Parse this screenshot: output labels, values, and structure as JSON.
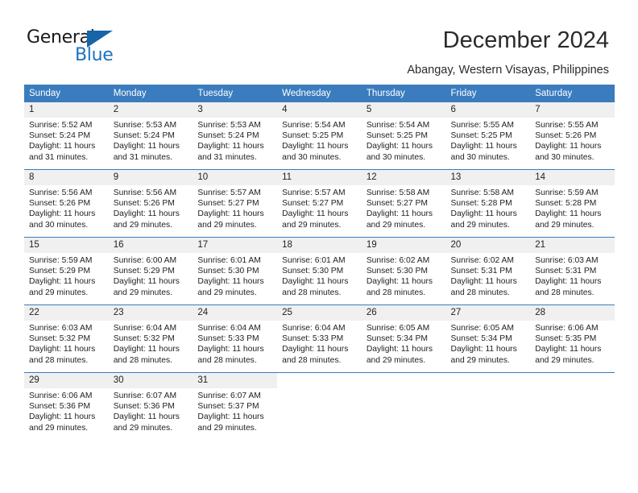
{
  "brand": {
    "name_part1": "General",
    "name_part2": "Blue",
    "flag_icon": "triangle-flag-icon"
  },
  "header": {
    "title": "December 2024",
    "location": "Abangay, Western Visayas, Philippines"
  },
  "colors": {
    "header_blue": "#3a7cbe",
    "brand_blue": "#1b72c0",
    "daynum_band": "#f0f0f0",
    "text": "#222222"
  },
  "weekday_headers": [
    "Sunday",
    "Monday",
    "Tuesday",
    "Wednesday",
    "Thursday",
    "Friday",
    "Saturday"
  ],
  "weeks": [
    [
      {
        "day": "1",
        "sunrise": "Sunrise: 5:52 AM",
        "sunset": "Sunset: 5:24 PM",
        "daylight_line1": "Daylight: 11 hours",
        "daylight_line2": "and 31 minutes."
      },
      {
        "day": "2",
        "sunrise": "Sunrise: 5:53 AM",
        "sunset": "Sunset: 5:24 PM",
        "daylight_line1": "Daylight: 11 hours",
        "daylight_line2": "and 31 minutes."
      },
      {
        "day": "3",
        "sunrise": "Sunrise: 5:53 AM",
        "sunset": "Sunset: 5:24 PM",
        "daylight_line1": "Daylight: 11 hours",
        "daylight_line2": "and 31 minutes."
      },
      {
        "day": "4",
        "sunrise": "Sunrise: 5:54 AM",
        "sunset": "Sunset: 5:25 PM",
        "daylight_line1": "Daylight: 11 hours",
        "daylight_line2": "and 30 minutes."
      },
      {
        "day": "5",
        "sunrise": "Sunrise: 5:54 AM",
        "sunset": "Sunset: 5:25 PM",
        "daylight_line1": "Daylight: 11 hours",
        "daylight_line2": "and 30 minutes."
      },
      {
        "day": "6",
        "sunrise": "Sunrise: 5:55 AM",
        "sunset": "Sunset: 5:25 PM",
        "daylight_line1": "Daylight: 11 hours",
        "daylight_line2": "and 30 minutes."
      },
      {
        "day": "7",
        "sunrise": "Sunrise: 5:55 AM",
        "sunset": "Sunset: 5:26 PM",
        "daylight_line1": "Daylight: 11 hours",
        "daylight_line2": "and 30 minutes."
      }
    ],
    [
      {
        "day": "8",
        "sunrise": "Sunrise: 5:56 AM",
        "sunset": "Sunset: 5:26 PM",
        "daylight_line1": "Daylight: 11 hours",
        "daylight_line2": "and 30 minutes."
      },
      {
        "day": "9",
        "sunrise": "Sunrise: 5:56 AM",
        "sunset": "Sunset: 5:26 PM",
        "daylight_line1": "Daylight: 11 hours",
        "daylight_line2": "and 29 minutes."
      },
      {
        "day": "10",
        "sunrise": "Sunrise: 5:57 AM",
        "sunset": "Sunset: 5:27 PM",
        "daylight_line1": "Daylight: 11 hours",
        "daylight_line2": "and 29 minutes."
      },
      {
        "day": "11",
        "sunrise": "Sunrise: 5:57 AM",
        "sunset": "Sunset: 5:27 PM",
        "daylight_line1": "Daylight: 11 hours",
        "daylight_line2": "and 29 minutes."
      },
      {
        "day": "12",
        "sunrise": "Sunrise: 5:58 AM",
        "sunset": "Sunset: 5:27 PM",
        "daylight_line1": "Daylight: 11 hours",
        "daylight_line2": "and 29 minutes."
      },
      {
        "day": "13",
        "sunrise": "Sunrise: 5:58 AM",
        "sunset": "Sunset: 5:28 PM",
        "daylight_line1": "Daylight: 11 hours",
        "daylight_line2": "and 29 minutes."
      },
      {
        "day": "14",
        "sunrise": "Sunrise: 5:59 AM",
        "sunset": "Sunset: 5:28 PM",
        "daylight_line1": "Daylight: 11 hours",
        "daylight_line2": "and 29 minutes."
      }
    ],
    [
      {
        "day": "15",
        "sunrise": "Sunrise: 5:59 AM",
        "sunset": "Sunset: 5:29 PM",
        "daylight_line1": "Daylight: 11 hours",
        "daylight_line2": "and 29 minutes."
      },
      {
        "day": "16",
        "sunrise": "Sunrise: 6:00 AM",
        "sunset": "Sunset: 5:29 PM",
        "daylight_line1": "Daylight: 11 hours",
        "daylight_line2": "and 29 minutes."
      },
      {
        "day": "17",
        "sunrise": "Sunrise: 6:01 AM",
        "sunset": "Sunset: 5:30 PM",
        "daylight_line1": "Daylight: 11 hours",
        "daylight_line2": "and 29 minutes."
      },
      {
        "day": "18",
        "sunrise": "Sunrise: 6:01 AM",
        "sunset": "Sunset: 5:30 PM",
        "daylight_line1": "Daylight: 11 hours",
        "daylight_line2": "and 28 minutes."
      },
      {
        "day": "19",
        "sunrise": "Sunrise: 6:02 AM",
        "sunset": "Sunset: 5:30 PM",
        "daylight_line1": "Daylight: 11 hours",
        "daylight_line2": "and 28 minutes."
      },
      {
        "day": "20",
        "sunrise": "Sunrise: 6:02 AM",
        "sunset": "Sunset: 5:31 PM",
        "daylight_line1": "Daylight: 11 hours",
        "daylight_line2": "and 28 minutes."
      },
      {
        "day": "21",
        "sunrise": "Sunrise: 6:03 AM",
        "sunset": "Sunset: 5:31 PM",
        "daylight_line1": "Daylight: 11 hours",
        "daylight_line2": "and 28 minutes."
      }
    ],
    [
      {
        "day": "22",
        "sunrise": "Sunrise: 6:03 AM",
        "sunset": "Sunset: 5:32 PM",
        "daylight_line1": "Daylight: 11 hours",
        "daylight_line2": "and 28 minutes."
      },
      {
        "day": "23",
        "sunrise": "Sunrise: 6:04 AM",
        "sunset": "Sunset: 5:32 PM",
        "daylight_line1": "Daylight: 11 hours",
        "daylight_line2": "and 28 minutes."
      },
      {
        "day": "24",
        "sunrise": "Sunrise: 6:04 AM",
        "sunset": "Sunset: 5:33 PM",
        "daylight_line1": "Daylight: 11 hours",
        "daylight_line2": "and 28 minutes."
      },
      {
        "day": "25",
        "sunrise": "Sunrise: 6:04 AM",
        "sunset": "Sunset: 5:33 PM",
        "daylight_line1": "Daylight: 11 hours",
        "daylight_line2": "and 28 minutes."
      },
      {
        "day": "26",
        "sunrise": "Sunrise: 6:05 AM",
        "sunset": "Sunset: 5:34 PM",
        "daylight_line1": "Daylight: 11 hours",
        "daylight_line2": "and 29 minutes."
      },
      {
        "day": "27",
        "sunrise": "Sunrise: 6:05 AM",
        "sunset": "Sunset: 5:34 PM",
        "daylight_line1": "Daylight: 11 hours",
        "daylight_line2": "and 29 minutes."
      },
      {
        "day": "28",
        "sunrise": "Sunrise: 6:06 AM",
        "sunset": "Sunset: 5:35 PM",
        "daylight_line1": "Daylight: 11 hours",
        "daylight_line2": "and 29 minutes."
      }
    ],
    [
      {
        "day": "29",
        "sunrise": "Sunrise: 6:06 AM",
        "sunset": "Sunset: 5:36 PM",
        "daylight_line1": "Daylight: 11 hours",
        "daylight_line2": "and 29 minutes."
      },
      {
        "day": "30",
        "sunrise": "Sunrise: 6:07 AM",
        "sunset": "Sunset: 5:36 PM",
        "daylight_line1": "Daylight: 11 hours",
        "daylight_line2": "and 29 minutes."
      },
      {
        "day": "31",
        "sunrise": "Sunrise: 6:07 AM",
        "sunset": "Sunset: 5:37 PM",
        "daylight_line1": "Daylight: 11 hours",
        "daylight_line2": "and 29 minutes."
      },
      {
        "day": "",
        "sunrise": "",
        "sunset": "",
        "daylight_line1": "",
        "daylight_line2": ""
      },
      {
        "day": "",
        "sunrise": "",
        "sunset": "",
        "daylight_line1": "",
        "daylight_line2": ""
      },
      {
        "day": "",
        "sunrise": "",
        "sunset": "",
        "daylight_line1": "",
        "daylight_line2": ""
      },
      {
        "day": "",
        "sunrise": "",
        "sunset": "",
        "daylight_line1": "",
        "daylight_line2": ""
      }
    ]
  ]
}
